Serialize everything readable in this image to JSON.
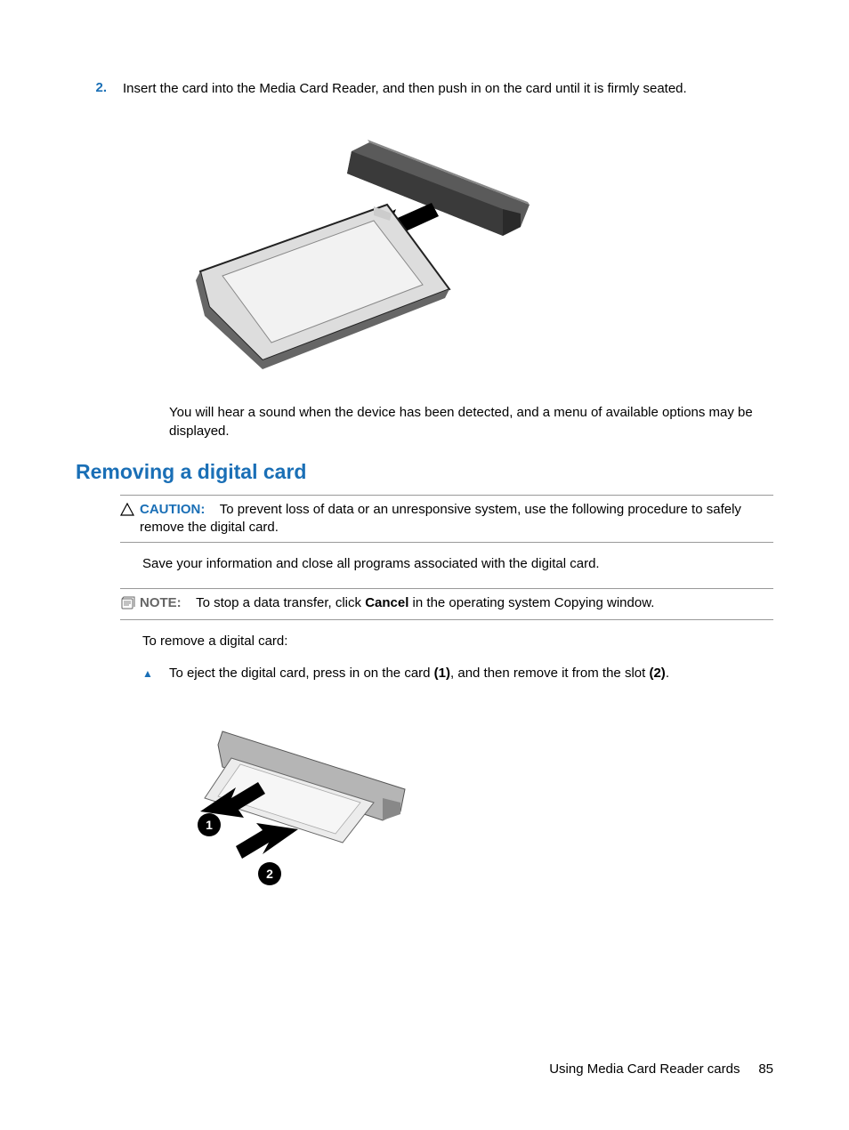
{
  "step2": {
    "num": "2.",
    "text": "Insert the card into the Media Card Reader, and then push in on the card until it is firmly seated."
  },
  "after_img1": "You will hear a sound when the device has been detected, and a menu of available options may be displayed.",
  "heading": "Removing a digital card",
  "caution": {
    "label": "CAUTION:",
    "text": "To prevent loss of data or an unresponsive system, use the following procedure to safely remove the digital card."
  },
  "save_text": "Save your information and close all programs associated with the digital card.",
  "note": {
    "label": "NOTE:",
    "before": "To stop a data transfer, click ",
    "bold": "Cancel",
    "after": " in the operating system Copying window."
  },
  "to_remove": "To remove a digital card:",
  "eject": {
    "t1": "To eject the digital card, press in on the card ",
    "b1": "(1)",
    "t2": ", and then remove it from the slot ",
    "b2": "(2)",
    "t3": "."
  },
  "footer": {
    "text": "Using Media Card Reader cards",
    "page": "85"
  }
}
